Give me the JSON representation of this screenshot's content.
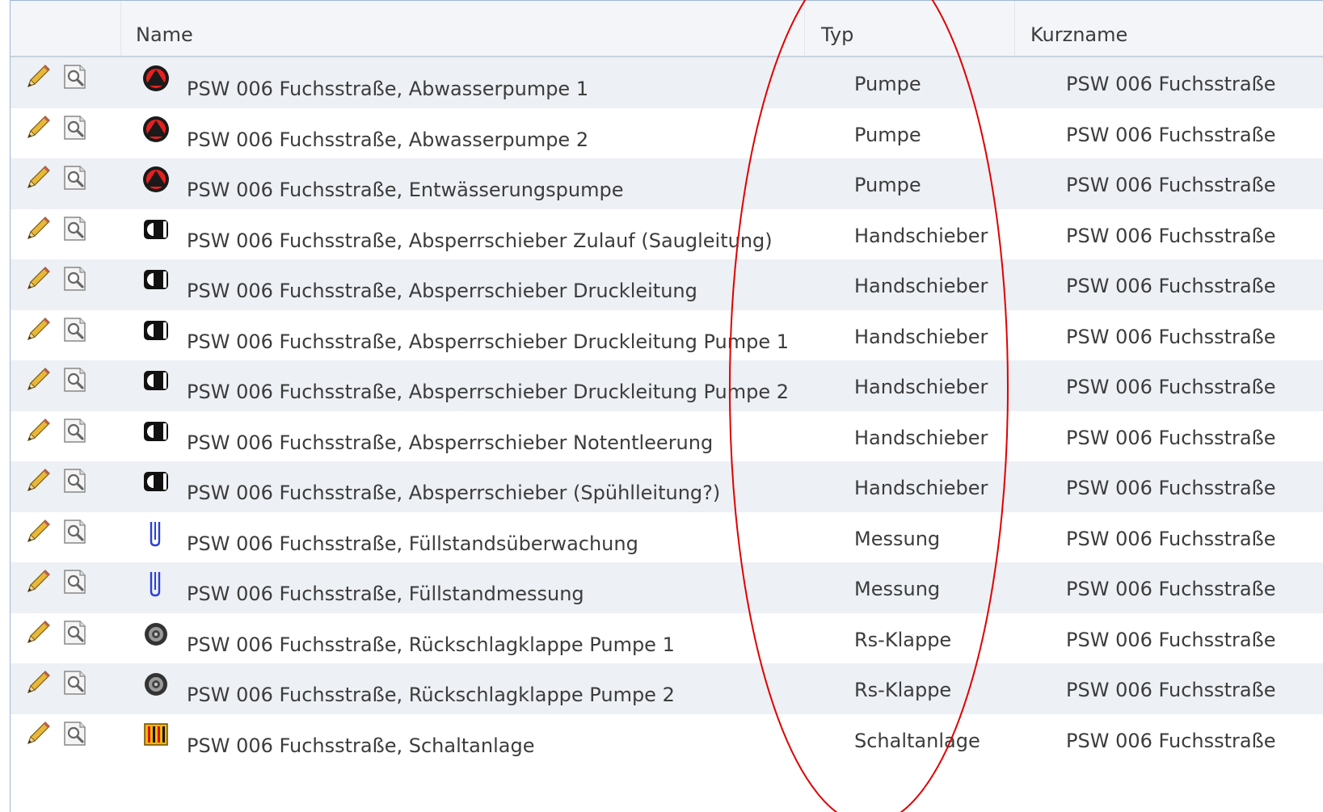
{
  "columns": {
    "name": "Name",
    "typ": "Typ",
    "kurzname": "Kurzname"
  },
  "colors": {
    "header_bg": "#f3f5f8",
    "row_alt": "#edf0f4",
    "annotation": "#e00000"
  },
  "rows": [
    {
      "icon": "pump-icon",
      "name": "PSW 006 Fuchsstraße, Abwasserpumpe 1",
      "typ": "Pumpe",
      "kurzname": "PSW 006 Fuchsstraße"
    },
    {
      "icon": "pump-icon",
      "name": "PSW 006 Fuchsstraße, Abwasserpumpe 2",
      "typ": "Pumpe",
      "kurzname": "PSW 006 Fuchsstraße"
    },
    {
      "icon": "pump-icon",
      "name": "PSW 006 Fuchsstraße, Entwässerungspumpe",
      "typ": "Pumpe",
      "kurzname": "PSW 006 Fuchsstraße"
    },
    {
      "icon": "gate-valve-icon",
      "name": "PSW 006 Fuchsstraße, Absperrschieber Zulauf (Saugleitung)",
      "typ": "Handschieber",
      "kurzname": "PSW 006 Fuchsstraße"
    },
    {
      "icon": "gate-valve-icon",
      "name": "PSW 006 Fuchsstraße, Absperrschieber Druckleitung",
      "typ": "Handschieber",
      "kurzname": "PSW 006 Fuchsstraße"
    },
    {
      "icon": "gate-valve-icon",
      "name": "PSW 006 Fuchsstraße, Absperrschieber Druckleitung Pumpe 1",
      "typ": "Handschieber",
      "kurzname": "PSW 006 Fuchsstraße"
    },
    {
      "icon": "gate-valve-icon",
      "name": "PSW 006 Fuchsstraße, Absperrschieber Druckleitung Pumpe 2",
      "typ": "Handschieber",
      "kurzname": "PSW 006 Fuchsstraße"
    },
    {
      "icon": "gate-valve-icon",
      "name": "PSW 006 Fuchsstraße, Absperrschieber Notentleerung",
      "typ": "Handschieber",
      "kurzname": "PSW 006 Fuchsstraße"
    },
    {
      "icon": "gate-valve-icon",
      "name": "PSW 006 Fuchsstraße, Absperrschieber (Spühlleitung?)",
      "typ": "Handschieber",
      "kurzname": "PSW 006 Fuchsstraße"
    },
    {
      "icon": "level-sensor-icon",
      "name": "PSW 006 Fuchsstraße, Füllstandsüberwachung",
      "typ": "Messung",
      "kurzname": "PSW 006 Fuchsstraße"
    },
    {
      "icon": "level-sensor-icon",
      "name": "PSW 006 Fuchsstraße, Füllstandmessung",
      "typ": "Messung",
      "kurzname": "PSW 006 Fuchsstraße"
    },
    {
      "icon": "check-valve-icon",
      "name": "PSW 006 Fuchsstraße, Rückschlagklappe Pumpe 1",
      "typ": "Rs-Klappe",
      "kurzname": "PSW 006 Fuchsstraße"
    },
    {
      "icon": "check-valve-icon",
      "name": "PSW 006 Fuchsstraße, Rückschlagklappe Pumpe 2",
      "typ": "Rs-Klappe",
      "kurzname": "PSW 006 Fuchsstraße"
    },
    {
      "icon": "switchgear-icon",
      "name": "PSW 006 Fuchsstraße, Schaltanlage",
      "typ": "Schaltanlage",
      "kurzname": "PSW 006 Fuchsstraße"
    }
  ]
}
